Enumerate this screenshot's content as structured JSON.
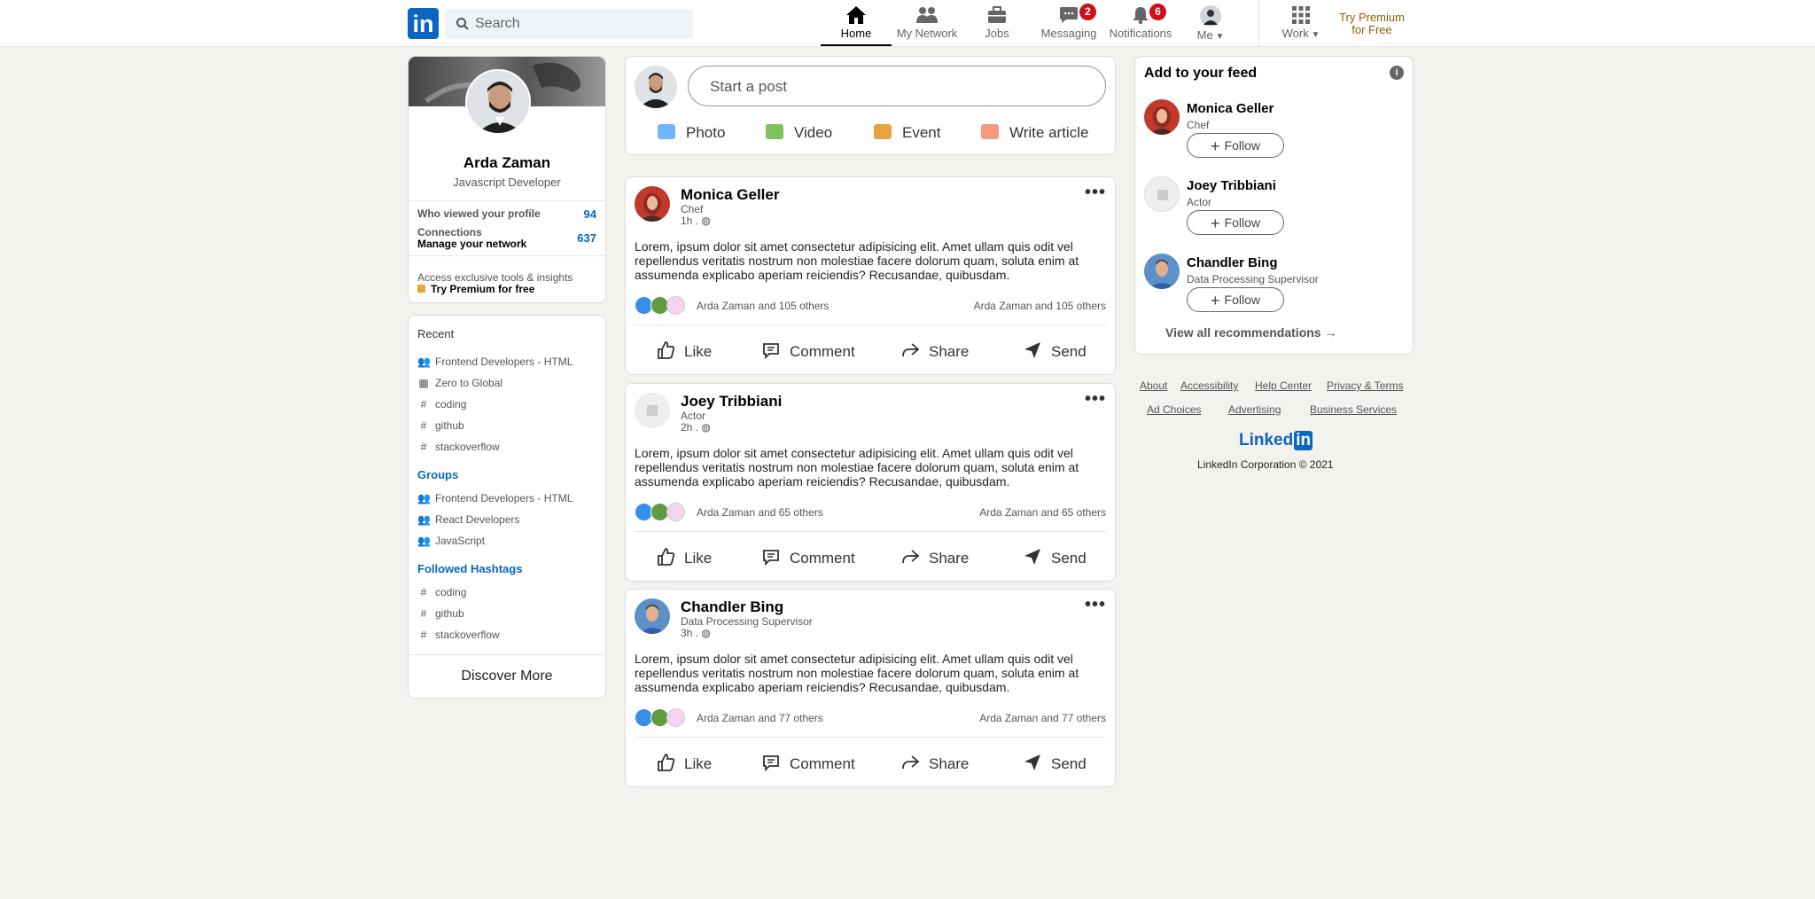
{
  "nav": {
    "logo": "in",
    "search_placeholder": "Search",
    "items": [
      {
        "label": "Home",
        "icon": "home-icon"
      },
      {
        "label": "My Network",
        "icon": "network-icon"
      },
      {
        "label": "Jobs",
        "icon": "briefcase-icon"
      },
      {
        "label": "Messaging",
        "icon": "chat-icon",
        "badge": "2"
      },
      {
        "label": "Notifications",
        "icon": "bell-icon",
        "badge": "6"
      },
      {
        "label": "Me",
        "icon": "avatar"
      },
      {
        "label": "Work",
        "icon": "grid-icon"
      }
    ],
    "premium": [
      "Try Premium",
      "for Free"
    ]
  },
  "profile": {
    "name": "Arda Zaman",
    "title": "Javascript Developer",
    "viewed_label": "Who viewed your profile",
    "viewed_count": "94",
    "connections_label": "Connections",
    "manage_label": "Manage your network",
    "connections_count": "637",
    "premium_text": "Access exclusive tools & insights",
    "premium_link": "Try Premium for free"
  },
  "sidebar": {
    "recent_label": "Recent",
    "recent": [
      "Frontend Developers - HTML",
      "Zero to Global",
      "coding",
      "github",
      "stackoverflow"
    ],
    "groups_label": "Groups",
    "groups": [
      "Frontend Developers - HTML",
      "React Developers",
      "JavaScript"
    ],
    "hashtags_label": "Followed Hashtags",
    "hashtags": [
      "coding",
      "github",
      "stackoverflow"
    ],
    "discover": "Discover More"
  },
  "composer": {
    "placeholder": "Start a post",
    "actions": [
      "Photo",
      "Video",
      "Event",
      "Write article"
    ]
  },
  "posts": [
    {
      "name": "Monica Geller",
      "subtitle": "Chef",
      "time": "1h .",
      "body": "Lorem, ipsum dolor sit amet consectetur adipisicing elit. Amet ullam quis odit vel repellendus veritatis nostrum non molestiae facere dolorum quam, soluta enim at assumenda explicabo aperiam reiciendis? Recusandae, quibusdam.",
      "reactions": "Arda Zaman and 105 others"
    },
    {
      "name": "Joey Tribbiani",
      "subtitle": "Actor",
      "time": "2h .",
      "body": "Lorem, ipsum dolor sit amet consectetur adipisicing elit. Amet ullam quis odit vel repellendus veritatis nostrum non molestiae facere dolorum quam, soluta enim at assumenda explicabo aperiam reiciendis? Recusandae, quibusdam.",
      "reactions": "Arda Zaman and 65 others"
    },
    {
      "name": "Chandler Bing",
      "subtitle": "Data Processing Supervisor",
      "time": "3h .",
      "body": "Lorem, ipsum dolor sit amet consectetur adipisicing elit. Amet ullam quis odit vel repellendus veritatis nostrum non molestiae facere dolorum quam, soluta enim at assumenda explicabo aperiam reiciendis? Recusandae, quibusdam.",
      "reactions": "Arda Zaman and 77 others"
    }
  ],
  "post_actions": [
    "Like",
    "Comment",
    "Share",
    "Send"
  ],
  "feed": {
    "title": "Add to your feed",
    "recs": [
      {
        "name": "Monica Geller",
        "subtitle": "Chef"
      },
      {
        "name": "Joey Tribbiani",
        "subtitle": "Actor"
      },
      {
        "name": "Chandler Bing",
        "subtitle": "Data Processing Supervisor"
      }
    ],
    "follow_label": "Follow",
    "view_all": "View all recommendations →"
  },
  "footer": {
    "links": [
      "About",
      "Accessibility",
      "Help Center",
      "Privacy & Terms",
      "Ad Choices",
      "Advertising",
      "Business Services"
    ],
    "brand": "Linked",
    "brand_in": "in",
    "copyright": "LinkedIn Corporation © 2021"
  },
  "colors": {
    "brand": "#0a66c2",
    "badge": "#cc1016",
    "premium": "#915907",
    "background": "#f3f2ef"
  }
}
